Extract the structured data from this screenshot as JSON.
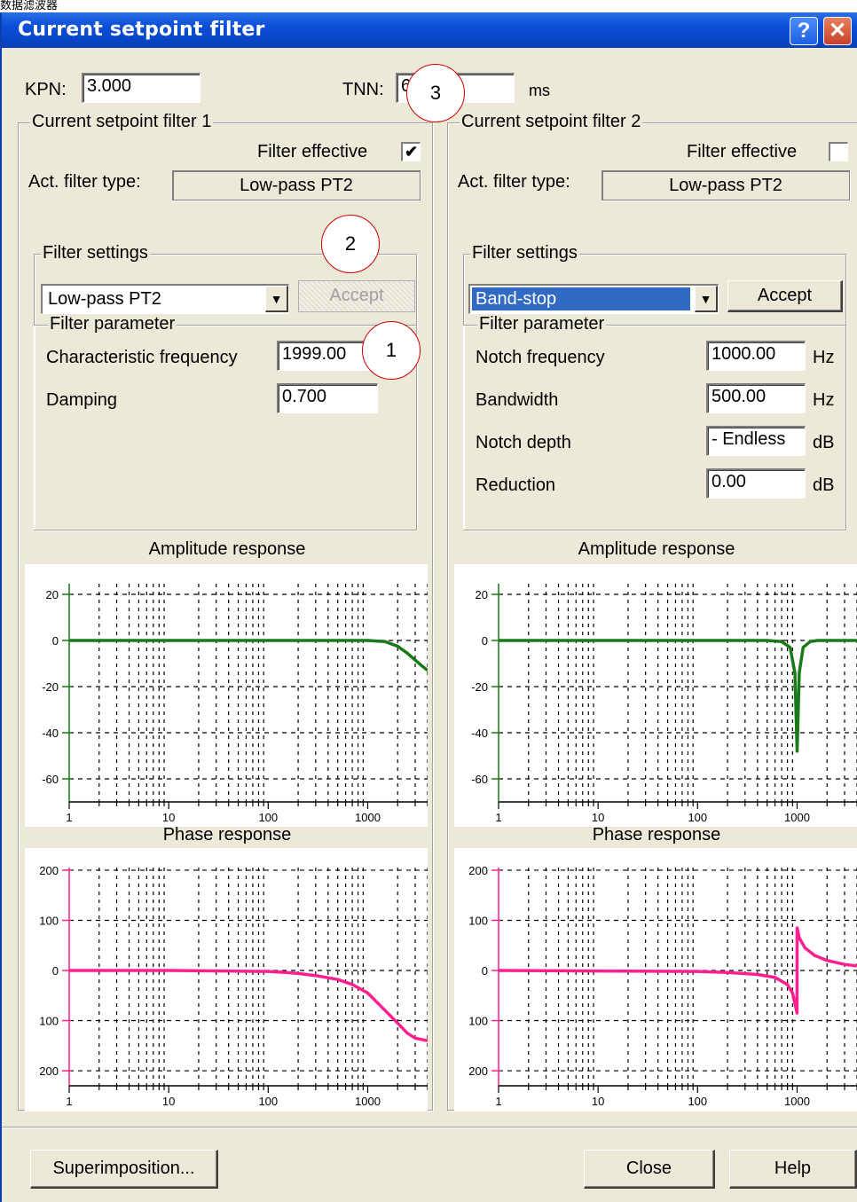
{
  "top_caption": "数据滤波器",
  "window": {
    "title": "Current setpoint filter",
    "help_glyph": "?",
    "close_glyph": "✕"
  },
  "kpn": {
    "label": "KPN:",
    "value": "3.000"
  },
  "tnn": {
    "label": "TNN:",
    "value": "6",
    "unit": "ms"
  },
  "filter1": {
    "group_label": "Current setpoint filter 1",
    "filter_effective_label": "Filter effective",
    "filter_effective_checked": true,
    "act_type_label": "Act. filter type:",
    "act_type_value": "Low-pass PT2",
    "settings_label": "Filter settings",
    "combo_value": "Low-pass PT2",
    "accept_label": "Accept",
    "accept_enabled": false,
    "param_label": "Filter parameter",
    "params": [
      {
        "label": "Characteristic frequency",
        "value": "1999.00",
        "unit": ""
      },
      {
        "label": "Damping",
        "value": "0.700",
        "unit": ""
      }
    ]
  },
  "filter2": {
    "group_label": "Current setpoint filter 2",
    "filter_effective_label": "Filter effective",
    "filter_effective_checked": false,
    "act_type_label": "Act. filter type:",
    "act_type_value": "Low-pass PT2",
    "settings_label": "Filter settings",
    "combo_value": "Band-stop",
    "accept_label": "Accept",
    "accept_enabled": true,
    "param_label": "Filter parameter",
    "params": [
      {
        "label": "Notch frequency",
        "value": "1000.00",
        "unit": "Hz"
      },
      {
        "label": "Bandwidth",
        "value": "500.00",
        "unit": "Hz"
      },
      {
        "label": "Notch depth",
        "value": "- Endless",
        "unit": "dB"
      },
      {
        "label": "Reduction",
        "value": "0.00",
        "unit": "dB"
      }
    ]
  },
  "callouts": [
    "3",
    "2",
    "1"
  ],
  "buttons": {
    "superimposition": "Superimposition...",
    "close": "Close",
    "help": "Help"
  },
  "colors": {
    "amplitude": "#1a7a1a",
    "phase": "#ff1f8f",
    "title_bar": "#0a4dd6"
  },
  "chart_data": [
    {
      "type": "line",
      "title": "Amplitude response",
      "x_scale": "log",
      "xlim": [
        1,
        4000
      ],
      "ylim": [
        -70,
        30
      ],
      "x_ticks": [
        1,
        10,
        100,
        1000
      ],
      "x_tick_labels": [
        "1",
        "10",
        "100",
        "1000"
      ],
      "y_ticks": [
        20,
        0,
        -20,
        -40,
        -60
      ],
      "y_tick_labels": [
        "20",
        "0",
        "-20",
        "-40",
        "-60"
      ],
      "series": [
        {
          "x": [
            1,
            10,
            100,
            500,
            1000,
            1500,
            2000,
            2500,
            3000,
            3500,
            4000
          ],
          "y": [
            0,
            0,
            0,
            0,
            0,
            -0.5,
            -2.5,
            -5.5,
            -8.5,
            -11,
            -13
          ]
        }
      ]
    },
    {
      "type": "line",
      "title": "Phase response",
      "x_scale": "log",
      "xlim": [
        1,
        4000
      ],
      "ylim": [
        -230,
        230
      ],
      "x_ticks": [
        1,
        10,
        100,
        1000
      ],
      "x_tick_labels": [
        "1",
        "10",
        "100",
        "1000"
      ],
      "y_ticks": [
        200,
        100,
        0,
        -100,
        -200
      ],
      "y_tick_labels": [
        "200",
        "100",
        "0",
        "100",
        "200"
      ],
      "series": [
        {
          "x": [
            1,
            10,
            100,
            150,
            200,
            300,
            500,
            700,
            1000,
            1500,
            2000,
            2500,
            3000,
            4000
          ],
          "y": [
            0,
            0,
            -2,
            -4,
            -6,
            -10,
            -18,
            -28,
            -45,
            -80,
            -105,
            -125,
            -135,
            -140
          ]
        }
      ]
    },
    {
      "type": "line",
      "title": "Amplitude response",
      "x_scale": "log",
      "xlim": [
        1,
        4000
      ],
      "ylim": [
        -70,
        30
      ],
      "x_ticks": [
        1,
        10,
        100,
        1000
      ],
      "x_tick_labels": [
        "1",
        "10",
        "100",
        "1000"
      ],
      "y_ticks": [
        20,
        0,
        -20,
        -40,
        -60
      ],
      "y_tick_labels": [
        "20",
        "0",
        "-20",
        "-40",
        "-60"
      ],
      "series": [
        {
          "x": [
            1,
            100,
            500,
            700,
            850,
            950,
            1000,
            1050,
            1150,
            1350,
            1600,
            2000,
            4000
          ],
          "y": [
            0,
            0,
            0,
            -0.5,
            -3,
            -14,
            -48,
            -14,
            -3,
            -0.5,
            0,
            0,
            0
          ]
        }
      ]
    },
    {
      "type": "line",
      "title": "Phase response",
      "x_scale": "log",
      "xlim": [
        1,
        4000
      ],
      "ylim": [
        -230,
        230
      ],
      "x_ticks": [
        1,
        10,
        100,
        1000
      ],
      "x_tick_labels": [
        "1",
        "10",
        "100",
        "1000"
      ],
      "y_ticks": [
        200,
        100,
        0,
        -100,
        -200
      ],
      "y_tick_labels": [
        "200",
        "100",
        "0",
        "100",
        "200"
      ],
      "series": [
        {
          "x": [
            1,
            10,
            100,
            200,
            400,
            600,
            800,
            900,
            950,
            999,
            1001,
            1050,
            1200,
            1500,
            2000,
            3000,
            4000
          ],
          "y": [
            0,
            -1,
            -2,
            -4,
            -8,
            -14,
            -28,
            -45,
            -65,
            -85,
            85,
            65,
            45,
            30,
            20,
            12,
            9
          ]
        }
      ]
    }
  ]
}
